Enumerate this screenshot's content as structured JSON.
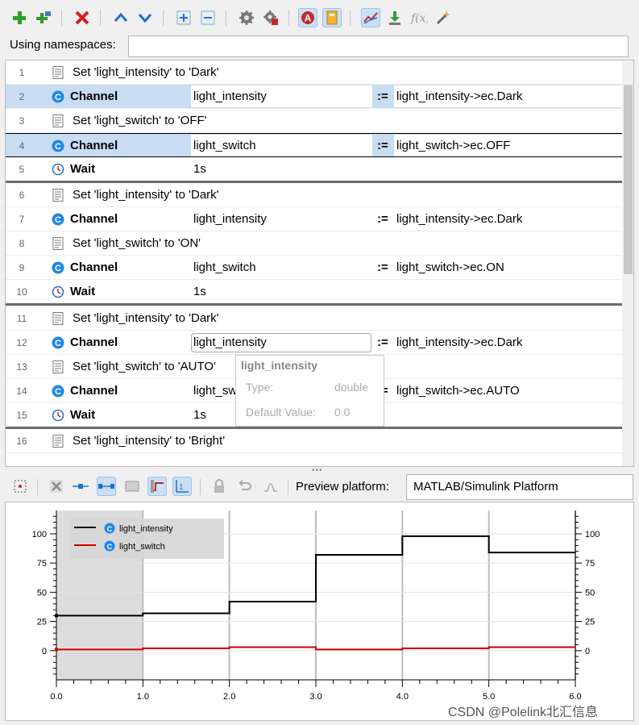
{
  "toolbar": {
    "buttons": [
      {
        "name": "add-icon",
        "color": "#2e9e2e"
      },
      {
        "name": "add-channel-icon",
        "color": "#2e9e2e"
      },
      {
        "name": "delete-icon",
        "color": "#d42020"
      },
      {
        "name": "move-up-icon",
        "color": "#1f6fd1"
      },
      {
        "name": "move-down-icon",
        "color": "#1f6fd1"
      },
      {
        "name": "expand-all-icon",
        "color": "#1f6fd1"
      },
      {
        "name": "collapse-all-icon",
        "color": "#1f6fd1"
      },
      {
        "name": "settings-icon",
        "color": "#666666"
      },
      {
        "name": "settings-alt-icon",
        "color": "#c62828"
      },
      {
        "name": "autocomplete-icon",
        "color": "#c62828"
      },
      {
        "name": "notebook-icon",
        "color": "#e0a020"
      },
      {
        "name": "signal-preview-icon",
        "color": "#c62828"
      },
      {
        "name": "download-icon",
        "color": "#3a9a3a"
      },
      {
        "name": "function-icon",
        "color": "#999999"
      },
      {
        "name": "magic-wand-icon",
        "color": "#e0a020"
      }
    ]
  },
  "namespaces": {
    "label": "Using namespaces:",
    "value": ""
  },
  "rows": [
    {
      "n": "1",
      "kind": "desc",
      "text": "Set 'light_intensity' to 'Dark'"
    },
    {
      "n": "2",
      "kind": "channel",
      "kw": "Channel",
      "name": "light_intensity",
      "assign": ":=",
      "value": "light_intensity->ec.Dark"
    },
    {
      "n": "3",
      "kind": "desc",
      "text": "Set 'light_switch' to 'OFF'"
    },
    {
      "n": "4",
      "kind": "channel",
      "kw": "Channel",
      "name": "light_switch",
      "assign": ":=",
      "value": "light_switch->ec.OFF"
    },
    {
      "n": "5",
      "kind": "wait",
      "kw": "Wait",
      "name": "1s"
    },
    {
      "n": "6",
      "kind": "desc",
      "text": "Set 'light_intensity' to 'Dark'"
    },
    {
      "n": "7",
      "kind": "channel",
      "kw": "Channel",
      "name": "light_intensity",
      "assign": ":=",
      "value": "light_intensity->ec.Dark"
    },
    {
      "n": "8",
      "kind": "desc",
      "text": "Set 'light_switch' to 'ON'"
    },
    {
      "n": "9",
      "kind": "channel",
      "kw": "Channel",
      "name": "light_switch",
      "assign": ":=",
      "value": "light_switch->ec.ON"
    },
    {
      "n": "10",
      "kind": "wait",
      "kw": "Wait",
      "name": "1s"
    },
    {
      "n": "11",
      "kind": "desc",
      "text": "Set 'light_intensity' to 'Dark'"
    },
    {
      "n": "12",
      "kind": "channel",
      "kw": "Channel",
      "name": "light_intensity",
      "assign": ":=",
      "value": "light_intensity->ec.Dark"
    },
    {
      "n": "13",
      "kind": "desc",
      "text": "Set 'light_switch' to 'AUTO'"
    },
    {
      "n": "14",
      "kind": "channel",
      "kw": "Channel",
      "name": "light_sw",
      "assign": ":=",
      "value": "light_switch->ec.AUTO"
    },
    {
      "n": "15",
      "kind": "wait",
      "kw": "Wait",
      "name": "1s"
    },
    {
      "n": "16",
      "kind": "desc",
      "text": "Set 'light_intensity' to 'Bright'"
    }
  ],
  "tooltip": {
    "title": "light_intensity",
    "type_label": "Type:",
    "type_value": "double",
    "default_label": "Default Value:",
    "default_value": "0.0"
  },
  "preview": {
    "label": "Preview platform:",
    "value": "MATLAB/Simulink Platform"
  },
  "chart_data": {
    "type": "line",
    "step": true,
    "xlim": [
      0,
      6.0
    ],
    "ylim": [
      -25,
      120
    ],
    "x_ticks": [
      "0.0",
      "1.0",
      "2.0",
      "3.0",
      "4.0",
      "5.0",
      "6.0"
    ],
    "y_ticks": [
      "0",
      "25",
      "50",
      "75",
      "100"
    ],
    "legend_position": "top-left",
    "shaded_x_range": [
      0,
      1.0
    ],
    "series": [
      {
        "name": "light_intensity",
        "color": "#000000",
        "x": [
          0,
          1,
          2,
          3,
          4,
          5,
          6
        ],
        "values": [
          30,
          32,
          42,
          82,
          98,
          84,
          84
        ]
      },
      {
        "name": "light_switch",
        "color": "#cc0000",
        "x": [
          0,
          1,
          2,
          3,
          4,
          5,
          6
        ],
        "values": [
          1,
          2,
          3,
          1,
          2,
          3,
          3
        ]
      }
    ]
  },
  "watermark": "CSDN @Polelink北汇信息"
}
